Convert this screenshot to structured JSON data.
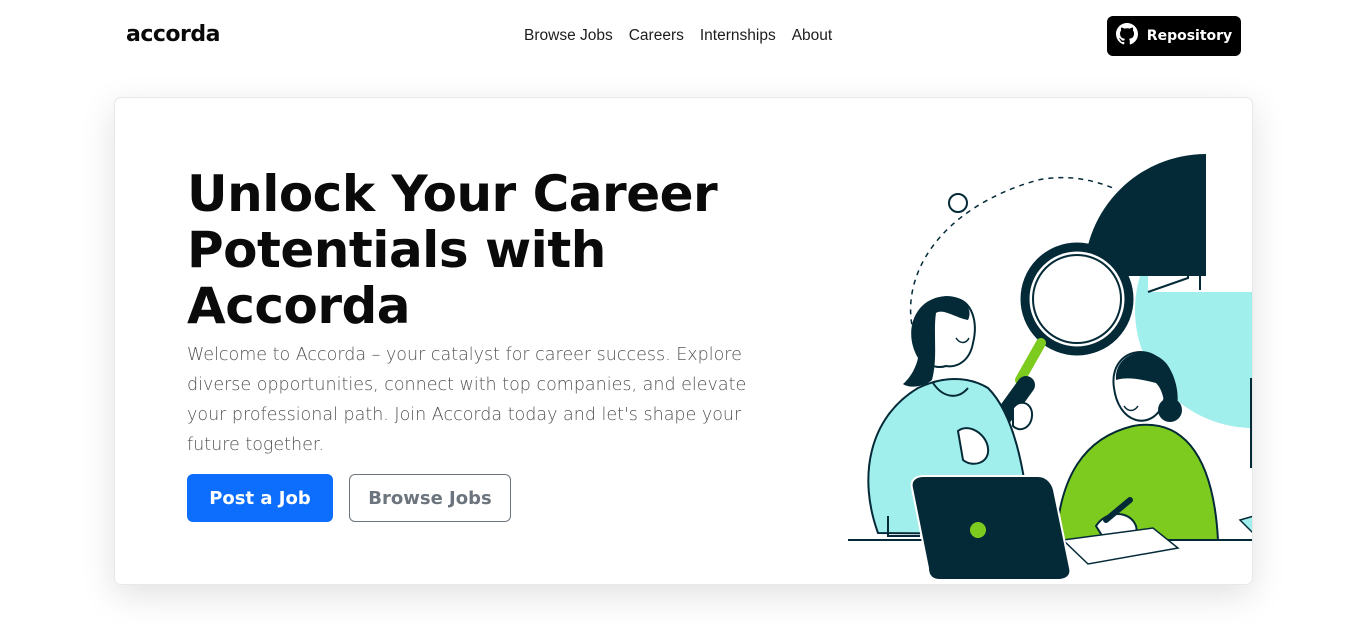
{
  "nav": {
    "brand": "accorda",
    "links": [
      "Browse Jobs",
      "Careers",
      "Internships",
      "About"
    ],
    "repo_label": "Repository",
    "repo_icon": "github-icon"
  },
  "hero": {
    "title": "Unlock Your Career Potentials with Accorda",
    "description": "Welcome to Accorda – your catalyst for career success. Explore diverse opportunities, connect with top companies, and elevate your professional path. Join Accorda today and let's shape your future together.",
    "primary_button": "Post a Job",
    "secondary_button": "Browse Jobs",
    "illustration": "job-search-illustration"
  },
  "colors": {
    "primary": "#0d6efd",
    "dark": "#042a38",
    "aqua": "#a1efed",
    "green": "#7ecb1f"
  }
}
